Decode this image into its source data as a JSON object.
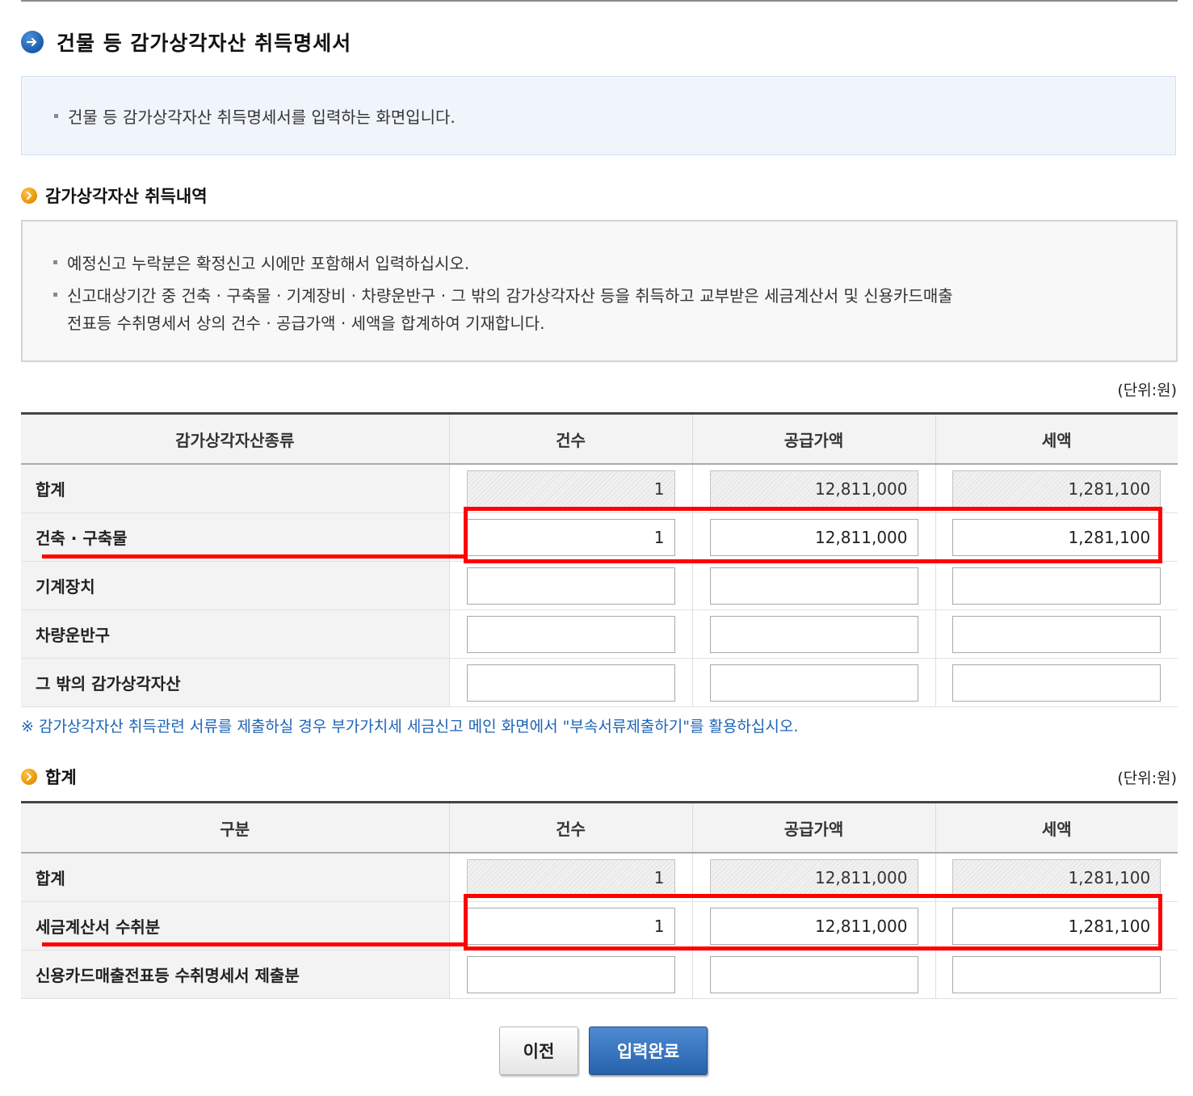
{
  "page": {
    "title": "건물 등 감가상각자산 취득명세서",
    "description": "건물 등 감가상각자산 취득명세서를 입력하는 화면입니다."
  },
  "section1": {
    "title": "감가상각자산 취득내역",
    "notes": [
      "예정신고 누락분은 확정신고 시에만 포함해서 입력하십시오.",
      "신고대상기간 중 건축 · 구축물 · 기계장비 · 차량운반구 · 그 밖의 감가상각자산 등을 취득하고 교부받은 세금계산서 및 신용카드매출",
      "전표등 수취명세서 상의 건수 · 공급가액 · 세액을 합계하여 기재합니다."
    ],
    "unit": "(단위:원)",
    "headers": [
      "감가상각자산종류",
      "건수",
      "공급가액",
      "세액"
    ],
    "rows": [
      {
        "label": "합계",
        "count": "1",
        "supply": "12,811,000",
        "tax": "1,281,100"
      },
      {
        "label": "건축 · 구축물",
        "count": "1",
        "supply": "12,811,000",
        "tax": "1,281,100"
      },
      {
        "label": "기계장치",
        "count": "",
        "supply": "",
        "tax": ""
      },
      {
        "label": "차량운반구",
        "count": "",
        "supply": "",
        "tax": ""
      },
      {
        "label": "그 밖의 감가상각자산",
        "count": "",
        "supply": "",
        "tax": ""
      }
    ],
    "footnote": "※ 감가상각자산 취득관련 서류를 제출하실 경우 부가가치세 세금신고 메인 화면에서 \"부속서류제출하기\"를 활용하십시오."
  },
  "section2": {
    "title": "합계",
    "unit": "(단위:원)",
    "headers": [
      "구분",
      "건수",
      "공급가액",
      "세액"
    ],
    "rows": [
      {
        "label": "합계",
        "count": "1",
        "supply": "12,811,000",
        "tax": "1,281,100"
      },
      {
        "label": "세금계산서 수취분",
        "count": "1",
        "supply": "12,811,000",
        "tax": "1,281,100"
      },
      {
        "label": "신용카드매출전표등 수취명세서 제출분",
        "count": "",
        "supply": "",
        "tax": ""
      }
    ]
  },
  "buttons": {
    "prev": "이전",
    "submit": "입력완료"
  },
  "colors": {
    "highlight": "#ff0000",
    "accent_blue": "#2763ad",
    "footnote": "#1c63b7"
  },
  "icons": {
    "title": "arrow-right-circle-icon",
    "section": "chevron-right-circle-icon"
  }
}
